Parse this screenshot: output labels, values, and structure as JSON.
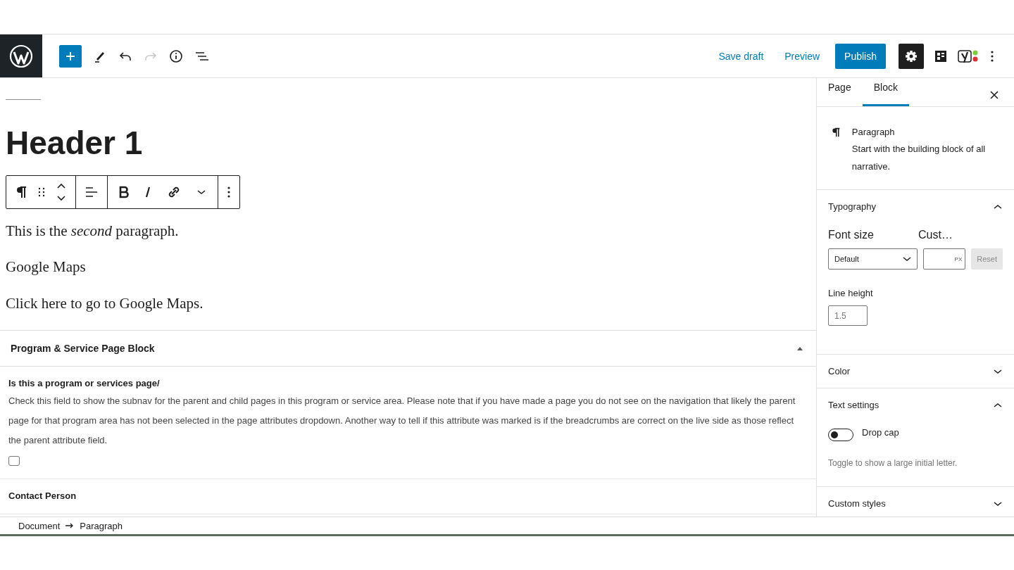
{
  "header": {
    "redo_disabled": true,
    "save_draft": "Save draft",
    "preview": "Preview",
    "publish": "Publish",
    "settings_pressed": true
  },
  "editor": {
    "title": "Header 1",
    "paragraphs": [
      "This is the *second* paragraph.",
      "Google Maps",
      "Click here to go to Google Maps."
    ]
  },
  "meta_box": {
    "title": "Program & Service Page Block",
    "expanded": true,
    "fields": [
      {
        "label": "Is this a program or services page/",
        "description": "Check this field to show the subnav for the parent and child pages in this program or service area. Please note that if you have made a page you do not see on the navigation that likely the parent page for that program area has not been selected in the page attributes dropdown. Another way to tell if this attribute was marked is if the breadcrumbs are correct on the live side as those reflect the parent attribute field.",
        "checked": false
      },
      {
        "label": "Contact Person"
      }
    ]
  },
  "breadcrumb": [
    "Document",
    "Paragraph"
  ],
  "sidebar": {
    "tabs": [
      {
        "label": "Page",
        "selected": false
      },
      {
        "label": "Block",
        "selected": true
      }
    ],
    "block": {
      "name": "Paragraph",
      "description": "Start with the building block of all narrative."
    },
    "panels": [
      {
        "kind": "typography",
        "title": "Typography",
        "expanded": true,
        "font_size_label": "Font size",
        "custom_label": "Cust…",
        "font_size_value": "Default",
        "unit": "PX",
        "reset": "Reset",
        "line_height_label": "Line height",
        "line_height_value": "1.5"
      },
      {
        "title": "Color",
        "expanded": false
      },
      {
        "kind": "text_settings",
        "title": "Text settings",
        "expanded": true,
        "toggle_label": "Drop cap",
        "on": false,
        "help": "Toggle to show a large initial letter."
      },
      {
        "title": "Custom styles",
        "expanded": false
      }
    ]
  }
}
